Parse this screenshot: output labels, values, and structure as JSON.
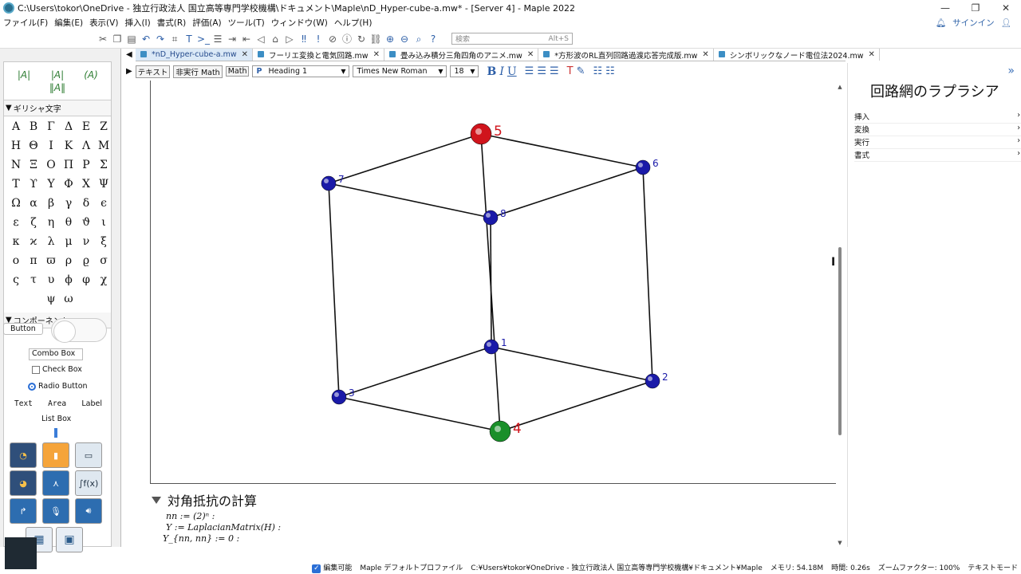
{
  "window": {
    "title": "C:\\Users\\tokor\\OneDrive - 独立行政法人 国立高等専門学校機構\\ドキュメント\\Maple\\nD_Hyper-cube-a.mw* - [Server 4] - Maple 2022",
    "minimize": "—",
    "maximize": "❐",
    "close": "✕"
  },
  "menu": {
    "items": [
      "ファイル(F)",
      "編集(E)",
      "表示(V)",
      "挿入(I)",
      "書式(R)",
      "評価(A)",
      "ツール(T)",
      "ウィンドウ(W)",
      "ヘルプ(H)"
    ],
    "signin": "サインイン"
  },
  "toolbar": {
    "search_placeholder": "検索",
    "search_shortcut": "Alt+S"
  },
  "palette": {
    "greek_header": "ギリシャ文字",
    "greek_letters": [
      "Α",
      "Β",
      "Γ",
      "Δ",
      "Ε",
      "Ζ",
      "Η",
      "Θ",
      "Ι",
      "Κ",
      "Λ",
      "Μ",
      "Ν",
      "Ξ",
      "Ο",
      "Π",
      "Ρ",
      "Σ",
      "Τ",
      "ϒ",
      "Υ",
      "Φ",
      "Χ",
      "Ψ",
      "Ω",
      "α",
      "β",
      "γ",
      "δ",
      "ϵ",
      "ε",
      "ζ",
      "η",
      "θ",
      "ϑ",
      "ι",
      "κ",
      "ϰ",
      "λ",
      "μ",
      "ν",
      "ξ",
      "ο",
      "π",
      "ϖ",
      "ρ",
      "ϱ",
      "σ",
      "ς",
      "τ",
      "υ",
      "ϕ",
      "φ",
      "χ",
      "",
      "",
      "ψ",
      "ω",
      "",
      ""
    ],
    "components_header": "コンポーネント",
    "button_label": "Button",
    "combo_label": "Combo Box",
    "check_label": "Check Box",
    "radio_label": "Radio Button",
    "text_label": "Text",
    "area_label": "Area",
    "label_label": "Label",
    "listbox_label": "List Box"
  },
  "tabs": [
    {
      "label": "*nD_Hyper-cube-a.mw",
      "active": true
    },
    {
      "label": "フーリエ変換と電気回路.mw",
      "active": false
    },
    {
      "label": "畳み込み積分三角四角のアニメ.mw",
      "active": false
    },
    {
      "label": "*方形波のRL直列回路過渡応答完成版.mw",
      "active": false
    },
    {
      "label": "シンボリックなノード電位法2024.mw",
      "active": false
    }
  ],
  "format": {
    "mode_text": "テキスト",
    "mode_nonexec": "非実行 Math",
    "mode_math": "Math",
    "style_prefix": "P",
    "style": "Heading 1",
    "font": "Times New Roman",
    "size": "18",
    "bold": "B",
    "italic": "I",
    "underline": "U"
  },
  "cube": {
    "vertex_labels": [
      "1",
      "2",
      "3",
      "4",
      "5",
      "6",
      "7",
      "8"
    ],
    "colors": {
      "red": "#d0141c",
      "green": "#1a8f2a",
      "blue": "#1a1aa8"
    }
  },
  "section": {
    "title": "対角抵抗の計算",
    "lines": [
      "nn := (2)ⁿ :",
      "Y := LaplacianMatrix(H) :",
      "Y_{nn, nn} := 0 :"
    ]
  },
  "right_panel": {
    "title": "回路網のラプラシア",
    "items": [
      "挿入",
      "変換",
      "実行",
      "書式"
    ]
  },
  "status": {
    "editable": "編集可能",
    "profile": "Maple デフォルトプロファイル",
    "path": "C:¥Users¥tokor¥OneDrive - 独立行政法人 国立高等専門学校機構¥ドキュメント¥Maple",
    "memory": "メモリ: 54.18M",
    "time": "時間: 0.26s",
    "zoom": "ズームファクター: 100%",
    "mode": "テキストモード"
  }
}
